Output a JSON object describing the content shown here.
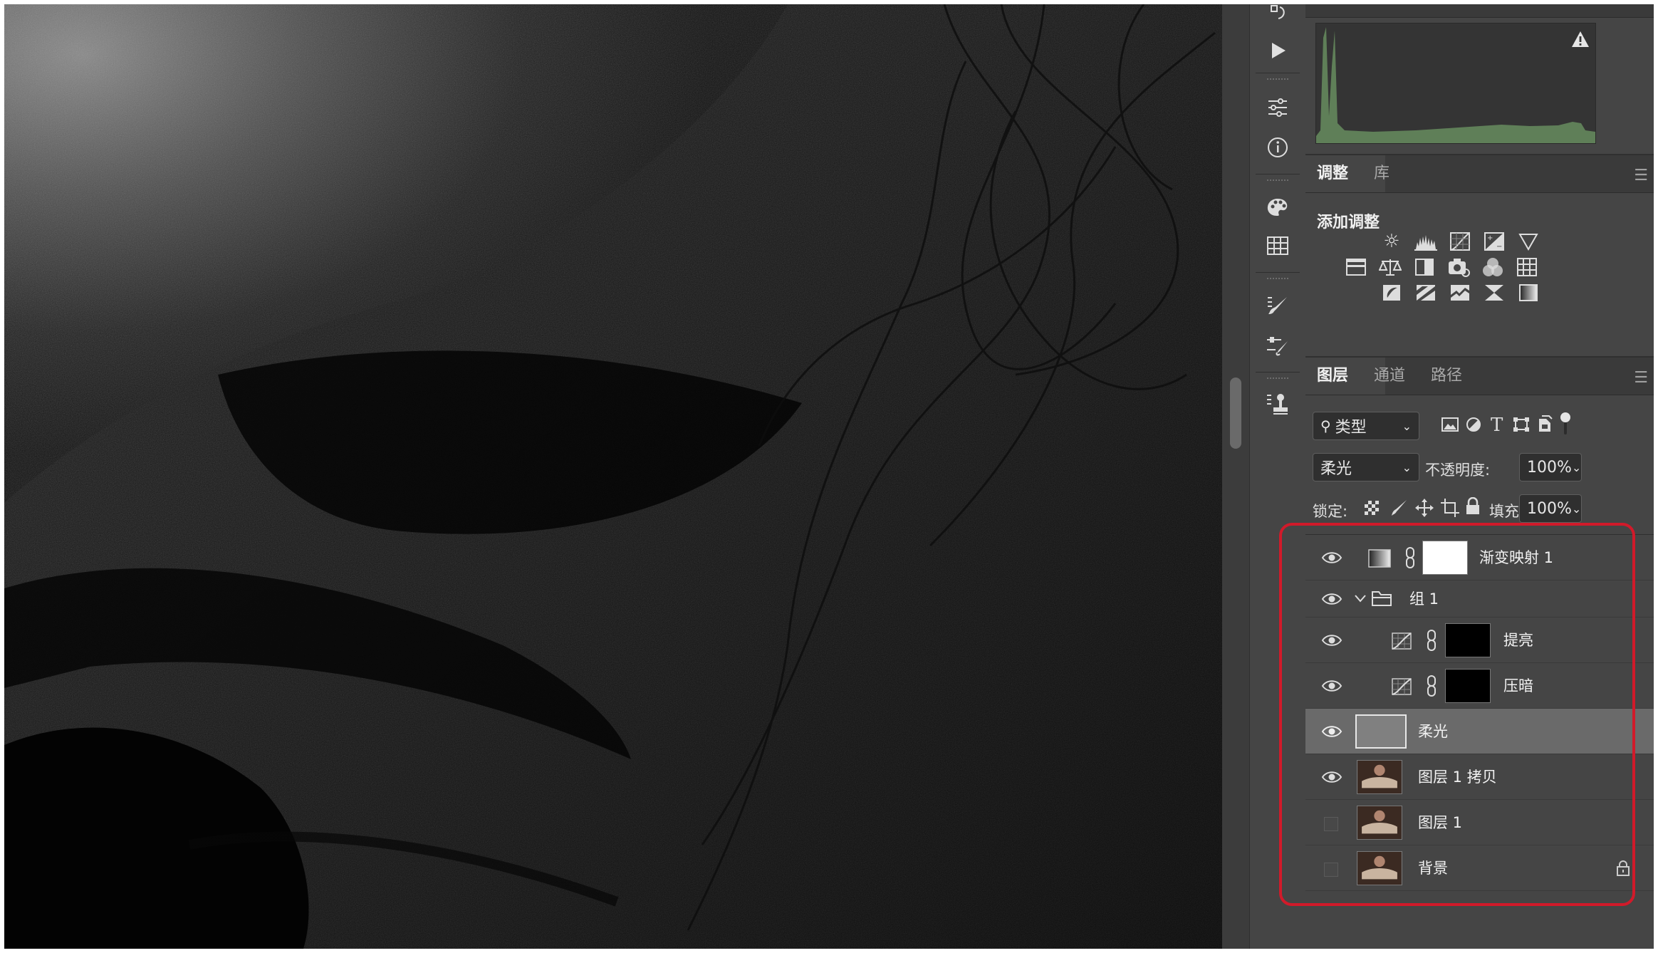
{
  "panels": {
    "adjust_tabs": [
      {
        "label": "调整",
        "active": true
      },
      {
        "label": "库",
        "active": false
      }
    ],
    "add_adjust_title": "添加调整",
    "adjust_icons": [
      [
        "brightness-contrast-icon",
        "levels-icon",
        "curves-icon",
        "exposure-icon",
        "vibrance-icon"
      ],
      [
        "hue-saturation-icon",
        "color-balance-icon",
        "black-white-icon",
        "photo-filter-icon",
        "channel-mixer-icon",
        "color-lookup-icon"
      ],
      [
        "invert-icon",
        "posterize-icon",
        "threshold-icon",
        "selective-color-icon",
        "gradient-map-icon"
      ]
    ],
    "layer_tabs": [
      {
        "label": "图层",
        "active": true
      },
      {
        "label": "通道",
        "active": false
      },
      {
        "label": "路径",
        "active": false
      }
    ]
  },
  "layers_toolbar": {
    "filter_kind": "类型",
    "blend_mode": "柔光",
    "opacity_label": "不透明度:",
    "opacity_value": "100%",
    "lock_label": "锁定:",
    "fill_label": "填充:",
    "fill_value": "100%"
  },
  "layers": [
    {
      "name": "渐变映射 1",
      "type": "gradient-map",
      "visible": true
    },
    {
      "name": "组 1",
      "type": "group",
      "visible": true
    },
    {
      "name": "提亮",
      "type": "curves",
      "visible": true
    },
    {
      "name": "压暗",
      "type": "curves",
      "visible": true
    },
    {
      "name": "柔光",
      "type": "fill",
      "visible": true,
      "selected": true
    },
    {
      "name": "图层 1 拷贝",
      "type": "image",
      "visible": true
    },
    {
      "name": "图层 1",
      "type": "image",
      "visible": false
    },
    {
      "name": "背景",
      "type": "image",
      "visible": false,
      "locked": true
    }
  ],
  "colors": {
    "panel": "#454545",
    "highlight_box": "#d11a2a",
    "histogram": "#5f7f58"
  }
}
